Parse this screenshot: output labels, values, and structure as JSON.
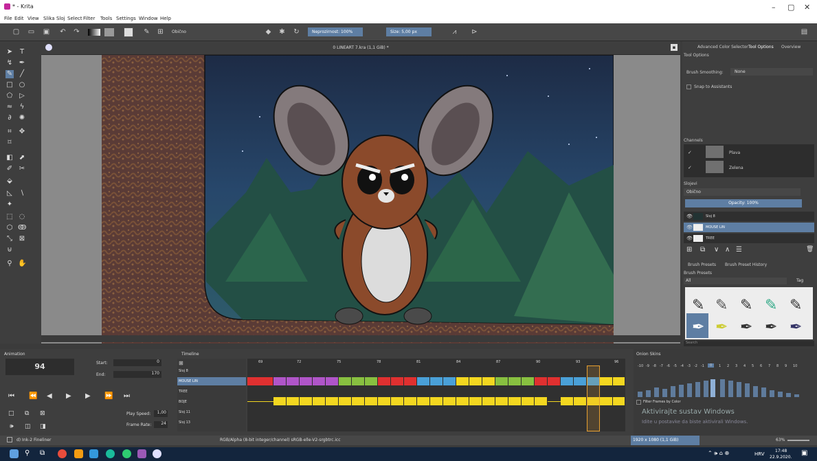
{
  "window": {
    "title": "* - Krita",
    "minimize": "–",
    "maximize": "▢",
    "close": "✕"
  },
  "menu": [
    "File",
    "Edit",
    "View",
    "Slika",
    "Sloj",
    "Select",
    "Filter",
    "Tools",
    "Settings",
    "Window",
    "Help"
  ],
  "toolbar": {
    "blend_mode": "Obično",
    "opacity": "Neprozirnost: 100%",
    "size": "Size: 5,00 px"
  },
  "document": {
    "tab_title": "0 LINEART 7.kra (1,1 GiB) *"
  },
  "right_dock": {
    "tabs": [
      "Advanced Color Selector",
      "Tool Options",
      "Overview"
    ],
    "tool_options_title": "Tool Options",
    "brush_smoothing_label": "Brush Smoothing:",
    "brush_smoothing_value": "None",
    "snap_label": "Snap to Assistants",
    "channels_title": "Channels",
    "channels": [
      {
        "name": "Plava"
      },
      {
        "name": "Zelena"
      }
    ],
    "layers_title": "Slojevi",
    "layers_blend": "Obično",
    "layers_opacity": "Opacity: 100%",
    "layers": [
      {
        "name": "Sloj 8"
      },
      {
        "name": "MOUSE LIN"
      },
      {
        "name": "TREE"
      }
    ],
    "preset_tabs": [
      "Brush Presets",
      "Brush Preset History"
    ],
    "presets_title": "Brush Presets",
    "presets_filter": "All",
    "presets_tag": "Tag",
    "search_placeholder": "Search"
  },
  "animation": {
    "title": "Animation",
    "frame": "94",
    "start_label": "Start:",
    "start_value": "0",
    "end_label": "End:",
    "end_value": "170",
    "play_speed_label": "Play Speed:",
    "play_speed_value": "1,00",
    "frame_rate_label": "Frame Rate:",
    "frame_rate_value": "24"
  },
  "timeline": {
    "title": "Timeline",
    "frame_numbers": [
      "69",
      "72",
      "75",
      "78",
      "81",
      "84",
      "87",
      "90",
      "93",
      "96"
    ],
    "layers": [
      "Sloj 8",
      "MOUSE LIN",
      "TREE",
      "BOJE",
      "Sloj 11",
      "Sloj 13"
    ]
  },
  "onion_skins": {
    "title": "Onion Skins",
    "numbers": [
      "-10",
      "-9",
      "-8",
      "-7",
      "-6",
      "-5",
      "-4",
      "-3",
      "-2",
      "-1",
      "0",
      "1",
      "2",
      "3",
      "4",
      "5",
      "6",
      "7",
      "8",
      "9",
      "10"
    ],
    "filter_label": "Filter Frames by Color"
  },
  "watermark": {
    "line1": "Aktivirajte sustav Windows",
    "line2": "Idite u postavke da biste aktivirali Windows."
  },
  "status": {
    "brush": "d) Ink-2 Fineliner",
    "color_info": "RGB/Alpha (8-bit integer/channel)  sRGB-elle-V2-srgbtrc.icc",
    "size": "1920 x 1080 (1,1 GiB)",
    "zoom": "63%"
  },
  "taskbar": {
    "lang": "HRV",
    "time": "17:48",
    "date": "22.9.2020."
  },
  "colors": {
    "accent": "#5e7ea3",
    "red": "#e03030",
    "purple": "#b055c8",
    "green": "#88c040",
    "blue": "#4aa0d8",
    "yellow": "#f3d720"
  }
}
